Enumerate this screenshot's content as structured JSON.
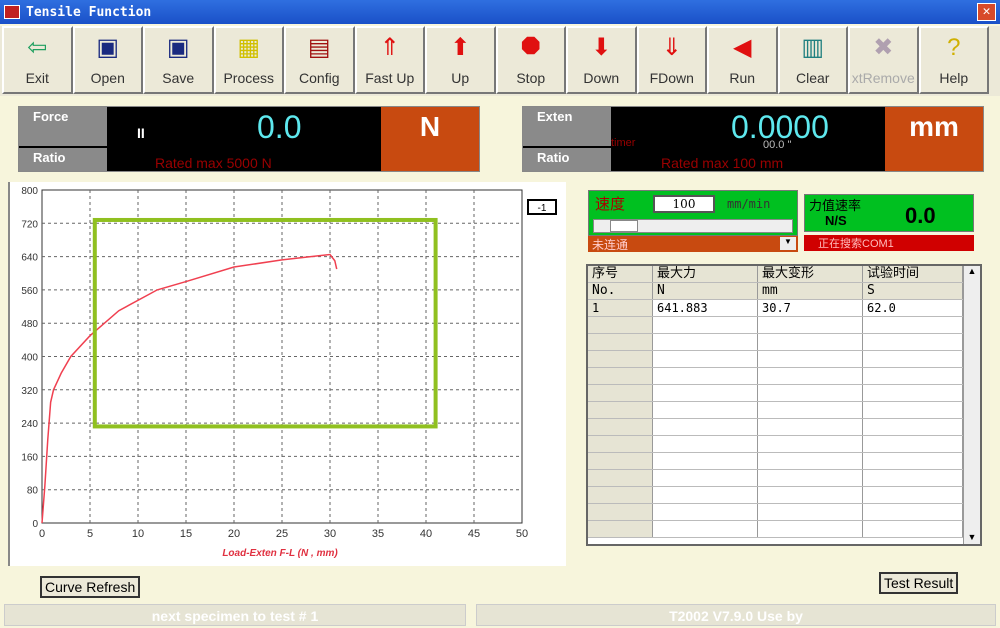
{
  "window": {
    "title": "Tensile Function",
    "close": "✕"
  },
  "toolbar": [
    {
      "label": "Exit",
      "icon": "exit-icon",
      "glyph": "⇦",
      "color": "#20a060"
    },
    {
      "label": "Open",
      "icon": "open-disk-icon",
      "glyph": "▣",
      "color": "#1a2a80"
    },
    {
      "label": "Save",
      "icon": "save-disk-icon",
      "glyph": "▣",
      "color": "#1a2a80"
    },
    {
      "label": "Process",
      "icon": "process-icon",
      "glyph": "▦",
      "color": "#d0c000"
    },
    {
      "label": "Config",
      "icon": "config-icon",
      "glyph": "▤",
      "color": "#a01010"
    },
    {
      "label": "Fast Up",
      "icon": "fast-up-icon",
      "glyph": "⇑",
      "color": "#e01010"
    },
    {
      "label": "Up",
      "icon": "up-arrow-icon",
      "glyph": "⬆",
      "color": "#e01010"
    },
    {
      "label": "Stop",
      "icon": "stop-icon",
      "glyph": "⯃",
      "color": "#e01010"
    },
    {
      "label": "Down",
      "icon": "down-arrow-icon",
      "glyph": "⬇",
      "color": "#e01010"
    },
    {
      "label": "FDown",
      "icon": "fast-down-icon",
      "glyph": "⇓",
      "color": "#e01010"
    },
    {
      "label": "Run",
      "icon": "run-icon",
      "glyph": "◀",
      "color": "#e01010"
    },
    {
      "label": "Clear",
      "icon": "clear-icon",
      "glyph": "▥",
      "color": "#208080"
    },
    {
      "label": "xtRemove",
      "icon": "remove-icon",
      "glyph": "✖",
      "color": "#b0a0b0",
      "disabled": true
    },
    {
      "label": "Help",
      "icon": "help-icon",
      "glyph": "?",
      "color": "#d0b000"
    }
  ],
  "force": {
    "label": "Force",
    "ratio": "Ratio",
    "indicator": "II",
    "value": "0.0",
    "unit": "N",
    "rated": "Rated max   5000 N"
  },
  "exten": {
    "label": "Exten",
    "ratio": "Ratio",
    "timer": "timer",
    "sub": "00.0  \"",
    "value": "0.0000",
    "unit": "mm",
    "rated": "Rated max   100 mm"
  },
  "speed": {
    "label": "速度",
    "value": "100",
    "unit": "mm/min",
    "mode": "未连通",
    "rate_label": "力值速率",
    "rate_unit": "N/S",
    "rate_value": "0.0",
    "status": "正在搜索COM1"
  },
  "table": {
    "headers": [
      "序号",
      "最大力",
      "最大变形",
      "试验时间"
    ],
    "units": [
      "No.",
      "N",
      "mm",
      "S"
    ],
    "rows": [
      [
        "1",
        "641.883",
        "30.7",
        "62.0"
      ]
    ]
  },
  "chart_data": {
    "type": "line",
    "title": "",
    "xlabel": "Load-Exten F-L    (N , mm)",
    "ylabel": "",
    "xlim": [
      0,
      50
    ],
    "ylim": [
      0,
      800
    ],
    "xticks": [
      0,
      5,
      10,
      15,
      20,
      25,
      30,
      35,
      40,
      45,
      50
    ],
    "yticks": [
      0,
      80,
      160,
      240,
      320,
      400,
      480,
      560,
      640,
      720,
      800
    ],
    "grid": true,
    "legend": "-1",
    "series": [
      {
        "name": "F-L",
        "color": "#f04050",
        "x": [
          0,
          0.3,
          0.6,
          0.9,
          1.2,
          2,
          3,
          5,
          8,
          12,
          15,
          20,
          25,
          28,
          30,
          30.5,
          30.7
        ],
        "y": [
          0,
          90,
          200,
          290,
          320,
          360,
          400,
          450,
          510,
          560,
          580,
          615,
          632,
          640,
          645,
          630,
          610
        ]
      }
    ],
    "highlight_box": {
      "x": [
        5.5,
        41
      ],
      "y": [
        232,
        728
      ],
      "color": "#90c020"
    }
  },
  "buttons": {
    "curve_refresh": "Curve Refresh",
    "test_result": "Test Result"
  },
  "status": {
    "left": "next specimen to test      # 1",
    "right": "T2002 V7.9.0 Use by"
  }
}
